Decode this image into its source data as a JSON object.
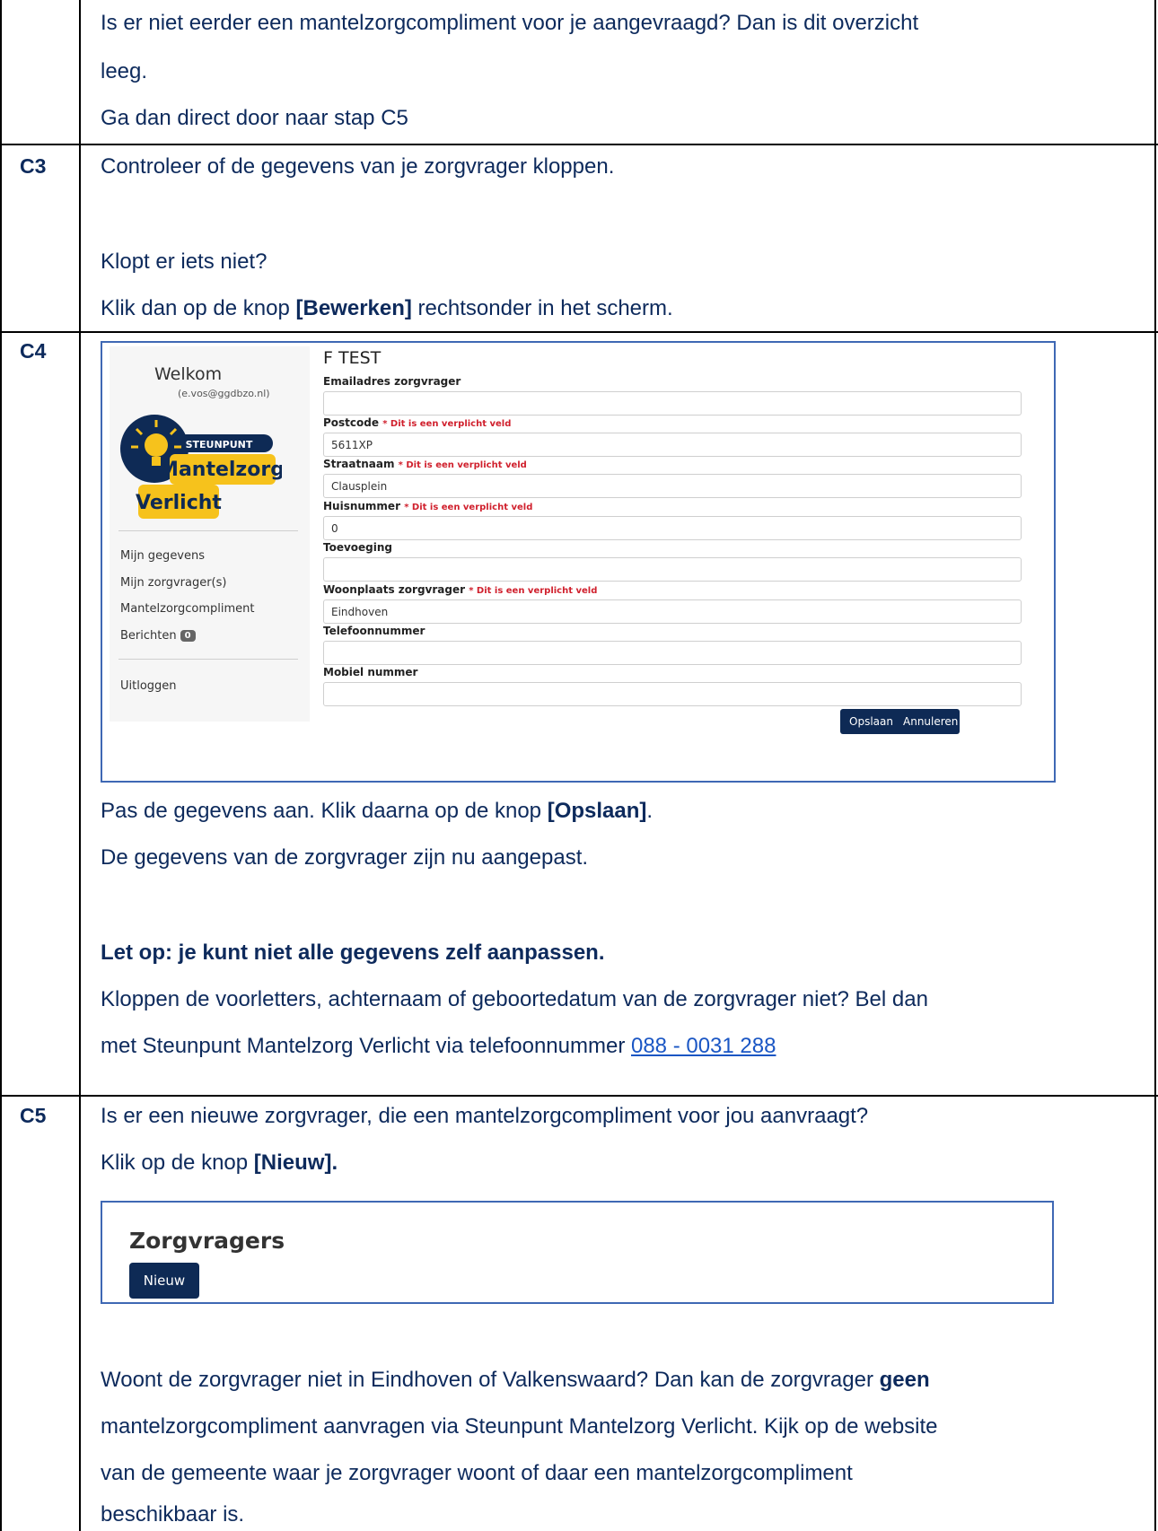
{
  "top_row": {
    "line1": "Is er niet eerder een mantelzorgcompliment voor je aangevraagd? Dan is dit overzicht",
    "line2": "leeg.",
    "line3": "Ga dan direct door naar stap C5"
  },
  "c3": {
    "step": "C3",
    "line1": "Controleer of de gegevens van je zorgvrager kloppen.",
    "line2": "Klopt er iets niet?",
    "line3_pre": "Klik dan op de knop ",
    "line3_bold": "[Bewerken]",
    "line3_post": " rechtsonder in het scherm."
  },
  "c4": {
    "step": "C4",
    "screenshot": {
      "welkom": "Welkom",
      "email": "(e.vos@ggdbzo.nl)",
      "logo": {
        "top": "STEUNPUNT",
        "middle": "Mantelzorg",
        "bottom": "Verlicht"
      },
      "menu": [
        "Mijn gegevens",
        "Mijn zorgvrager(s)",
        "Mantelzorgcompliment",
        "Berichten"
      ],
      "badge": "0",
      "logout": "Uitloggen",
      "form_title": "F TEST",
      "required_note": "* Dit is een verplicht veld",
      "fields": [
        {
          "label": "Emailadres zorgvrager",
          "value": ""
        },
        {
          "label": "Postcode",
          "value": "5611XP"
        },
        {
          "label": "Straatnaam",
          "value": "Clausplein"
        },
        {
          "label": "Huisnummer",
          "value": "0"
        },
        {
          "label": "Toevoeging",
          "value": ""
        },
        {
          "label": "Woonplaats zorgvrager",
          "value": "Eindhoven"
        },
        {
          "label": "Telefoonnummer",
          "value": ""
        },
        {
          "label": "Mobiel nummer",
          "value": ""
        }
      ],
      "save_label": "Opslaan",
      "cancel_label": "Annuleren"
    },
    "line1_pre": "Pas de gegevens aan. Klik daarna op de knop ",
    "line1_bold": "[Opslaan]",
    "line1_post": ".",
    "line2": "De gegevens van de zorgvrager zijn nu aangepast.",
    "note_bold": "Let op: je kunt niet alle gegevens zelf aanpassen.",
    "line3": "Kloppen de voorletters, achternaam of geboortedatum van de zorgvrager niet? Bel dan",
    "line4_pre": "met Steunpunt Mantelzorg Verlicht via telefoonnummer ",
    "phone": "088 - 0031 288"
  },
  "c5": {
    "step": "C5",
    "line1": "Is er een nieuwe zorgvrager, die een mantelzorgcompliment voor jou aanvraagt?",
    "line2_pre": "Klik op de knop ",
    "line2_bold": "[Nieuw].",
    "screenshot": {
      "title": "Zorgvragers",
      "button": "Nieuw"
    },
    "p1_pre": "Woont de zorgvrager niet in Eindhoven of Valkenswaard? Dan kan de zorgvrager ",
    "p1_bold": "geen",
    "p2": "mantelzorgcompliment aanvragen via Steunpunt Mantelzorg Verlicht. Kijk op de website",
    "p3": "van de gemeente waar je zorgvrager woont of daar een mantelzorgcompliment",
    "p4": "beschikbaar is."
  }
}
